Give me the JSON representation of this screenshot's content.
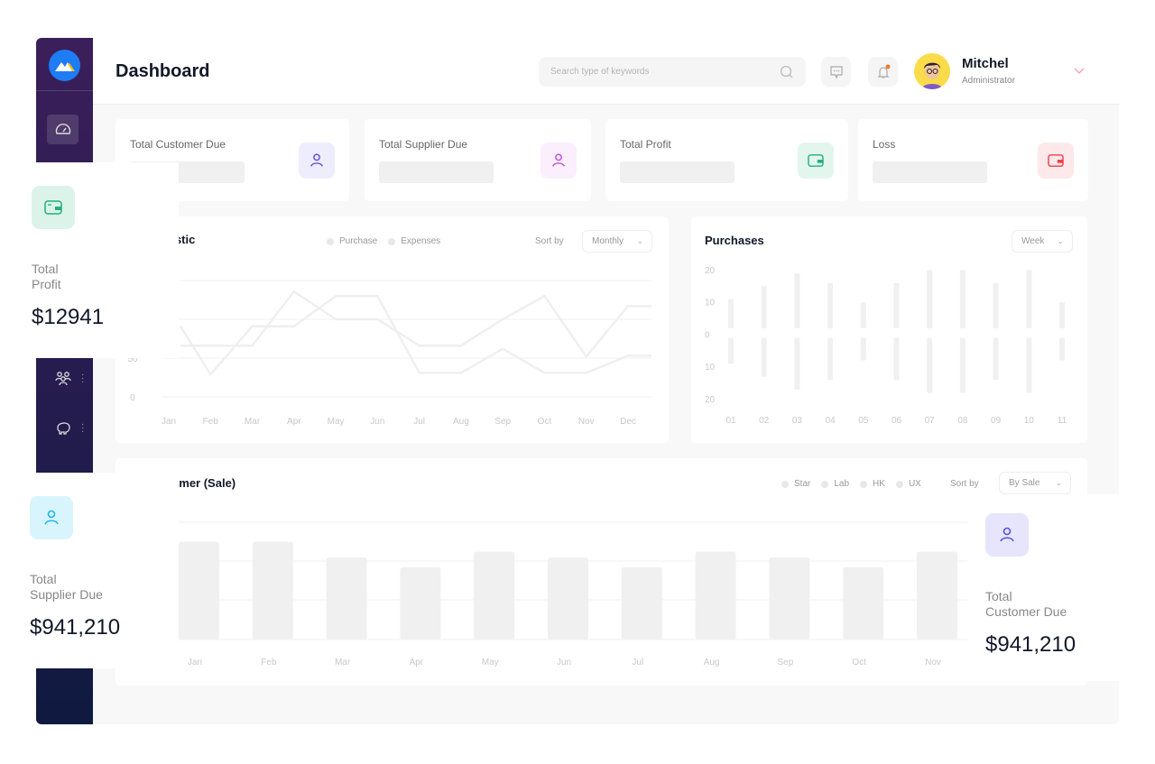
{
  "header": {
    "title": "Dashboard",
    "search_placeholder": "Search type of keywords",
    "user": {
      "name": "Mitchel",
      "role": "Administrator"
    }
  },
  "kpis": [
    {
      "label": "Total Customer Due",
      "icon": "user-icon",
      "color": "#5b4fe0",
      "bg": "#eeedfd"
    },
    {
      "label": "Total Supplier Due",
      "icon": "user-icon",
      "color": "#c04fd6",
      "bg": "#fbeefd"
    },
    {
      "label": "Total Profit",
      "icon": "wallet-icon",
      "color": "#22b07d",
      "bg": "#e3f6ee"
    },
    {
      "label": "Loss",
      "icon": "wallet-icon",
      "color": "#ef3b4a",
      "bg": "#fde8ea"
    }
  ],
  "floating": {
    "profit": {
      "label1": "Total",
      "label2": "Profit",
      "value": "$12941"
    },
    "supplier": {
      "label1": "Total",
      "label2": "Supplier Due",
      "value": "$941,210"
    },
    "customer": {
      "label1": "Total",
      "label2": "Customer Due",
      "value": "$941,210"
    }
  },
  "chart_data": [
    {
      "type": "line",
      "title": "tistic",
      "legend": [
        "Purchase",
        "Expenses"
      ],
      "sort_label": "Sort by",
      "sort_value": "Monthly",
      "categories": [
        "Jan",
        "Feb",
        "Mar",
        "Apr",
        "May",
        "Jun",
        "Jul",
        "Aug",
        "Sep",
        "Oct",
        "Nov",
        "Dec"
      ],
      "yticks": [
        "0",
        "50"
      ],
      "ylim": [
        0,
        150
      ],
      "grid": true,
      "series": [
        {
          "name": "Purchase",
          "values": [
            91,
            29,
            91,
            91,
            130,
            130,
            31,
            31,
            62,
            31,
            31,
            53
          ]
        },
        {
          "name": "Expenses",
          "values": [
            66,
            66,
            66,
            136,
            100,
            100,
            66,
            66,
            100,
            130,
            52,
            117
          ]
        }
      ]
    },
    {
      "type": "bar",
      "title": "Purchases",
      "sort_value": "Week",
      "categories": [
        "01",
        "02",
        "03",
        "04",
        "05",
        "06",
        "07",
        "08",
        "09",
        "10",
        "11"
      ],
      "yticks": [
        "20",
        "10",
        "0",
        "10",
        "20"
      ],
      "ylim": [
        -20,
        20
      ],
      "positive": [
        11,
        15,
        19,
        16,
        10,
        16,
        20,
        20,
        16,
        20,
        10
      ],
      "negative": [
        -9,
        -13,
        -17,
        -14,
        -8,
        -14,
        -18,
        -18,
        -14,
        -18,
        -8
      ]
    },
    {
      "type": "bar",
      "title": "tomer (Sale)",
      "legend": [
        "Star",
        "Lab",
        "HK",
        "UX"
      ],
      "sort_label": "Sort by",
      "sort_value": "By Sale",
      "categories": [
        "Jan",
        "Feb",
        "Mar",
        "Apr",
        "May",
        "Jun",
        "Jul",
        "Aug",
        "Sep",
        "Oct",
        "Nov"
      ],
      "values": [
        2.5,
        2.5,
        2.1,
        1.85,
        2.25,
        2.1,
        1.85,
        2.25,
        2.1,
        1.85,
        2.25
      ],
      "ylim": [
        0,
        3
      ],
      "grid": true
    }
  ]
}
